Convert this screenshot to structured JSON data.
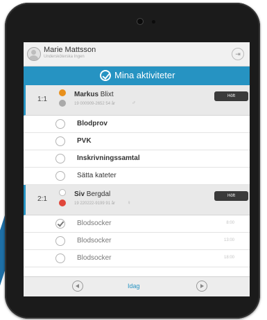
{
  "user": {
    "name": "Marie  Mattsson",
    "subtitle": "Undersköterska Ingen"
  },
  "header": {
    "title": "Mina aktiviteter",
    "logout_icon": "logout-icon"
  },
  "patients": [
    {
      "bed": "1:1",
      "first_name": "Markus",
      "last_name": " Blixt",
      "info": "19 000909-2652 54 år",
      "gender_symbol": "♂",
      "badge": "Höft",
      "status_colors": [
        "#e8901c",
        "#a9a9a9"
      ],
      "activities": [
        {
          "label": "Blodprov",
          "style": "bold",
          "checked": false,
          "time": ""
        },
        {
          "label": "PVK",
          "style": "bold",
          "checked": false,
          "time": ""
        },
        {
          "label": "Inskrivningssamtal",
          "style": "bold",
          "checked": false,
          "time": ""
        },
        {
          "label": "Sätta kateter",
          "style": "normal",
          "checked": false,
          "time": ""
        }
      ]
    },
    {
      "bed": "2:1",
      "first_name": "Siv",
      "last_name": " Bergdal",
      "info": "19 220222-9199 91 år",
      "gender_symbol": "♀",
      "badge": "Höft",
      "status_colors": [
        "#ffffff",
        "#e0463a"
      ],
      "activities": [
        {
          "label": "Blodsocker",
          "style": "light",
          "checked": true,
          "time": "8:00"
        },
        {
          "label": "Blodsocker",
          "style": "light",
          "checked": false,
          "time": "13:00"
        },
        {
          "label": "Blodsocker",
          "style": "light",
          "checked": false,
          "time": "18:00"
        }
      ]
    }
  ],
  "footer": {
    "today_label": "Idag",
    "prev_icon": "arrow-left-icon",
    "next_icon": "arrow-right-icon"
  },
  "colors": {
    "accent": "#2693c2",
    "tablet_bezel": "#1b1b1b",
    "badge": "#3a3a3a"
  }
}
